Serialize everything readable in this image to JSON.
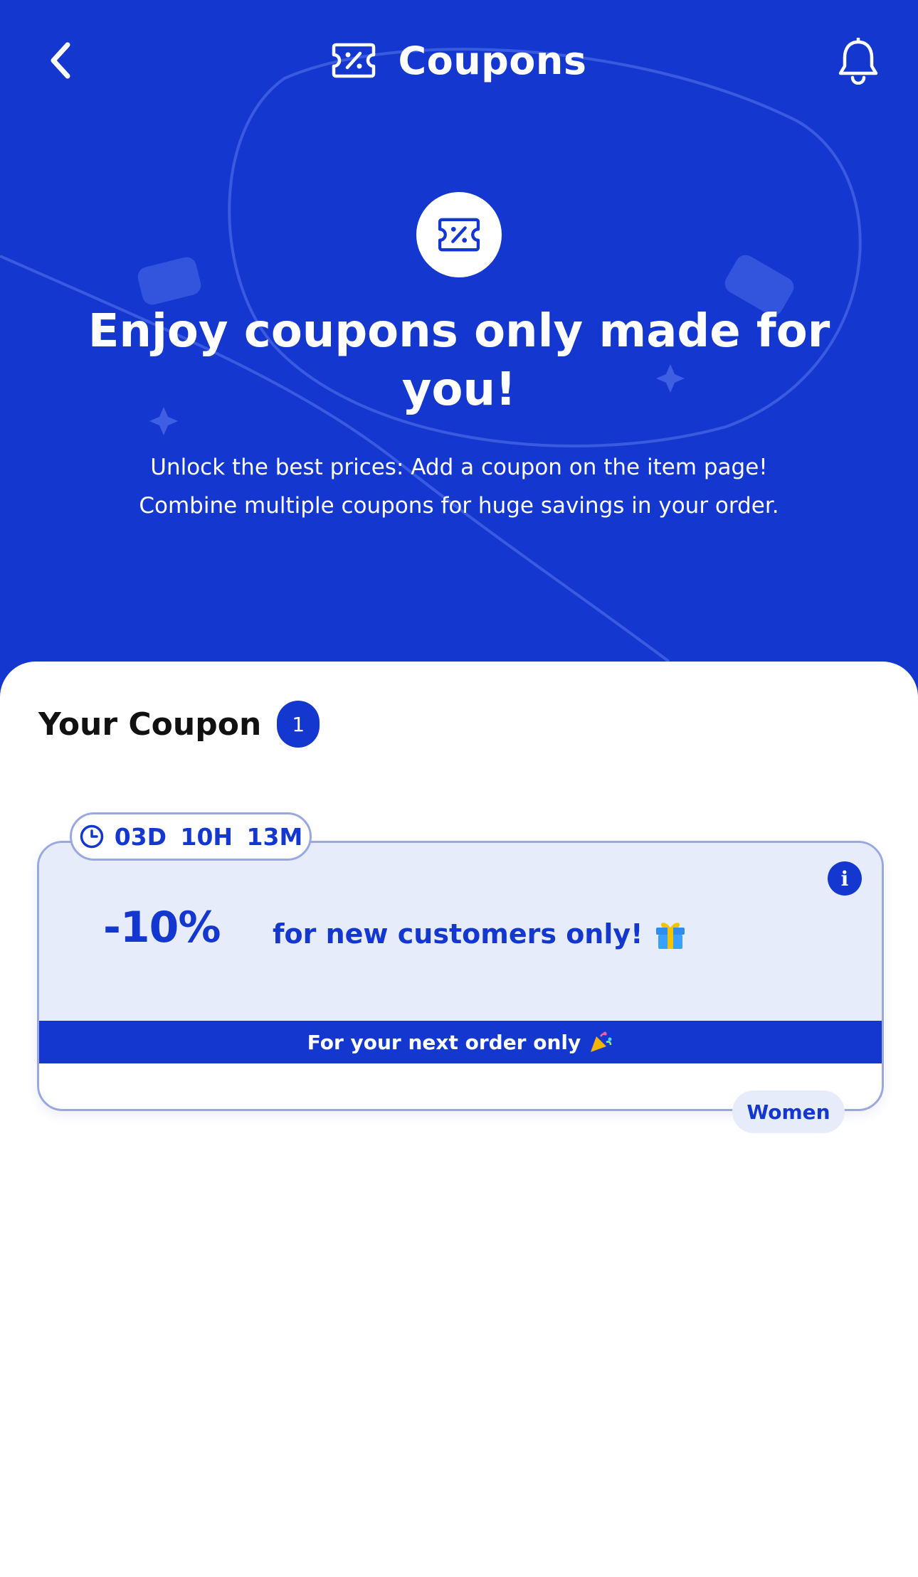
{
  "header": {
    "title": "Coupons",
    "back_icon": "chevron-left-icon",
    "title_icon": "coupon-percent-icon",
    "bell_icon": "bell-icon"
  },
  "hero": {
    "heading": "Enjoy coupons only made for you!",
    "subtitle_lines": [
      "Unlock the best prices: Add a coupon on the item page!",
      "Combine multiple coupons for huge savings in your order."
    ]
  },
  "section": {
    "title": "Your Coupon",
    "count": "1"
  },
  "coupon": {
    "timer": "03D 10H 13M",
    "discount": "-10%",
    "description": "for new customers only!",
    "strip_text": "For your next order only",
    "tag": "Women",
    "info_label": "i"
  },
  "colors": {
    "brand_blue": "#1438cf",
    "card_tint": "#e6ecfa",
    "card_border": "#9aa9dd",
    "text_dark": "#111111"
  }
}
